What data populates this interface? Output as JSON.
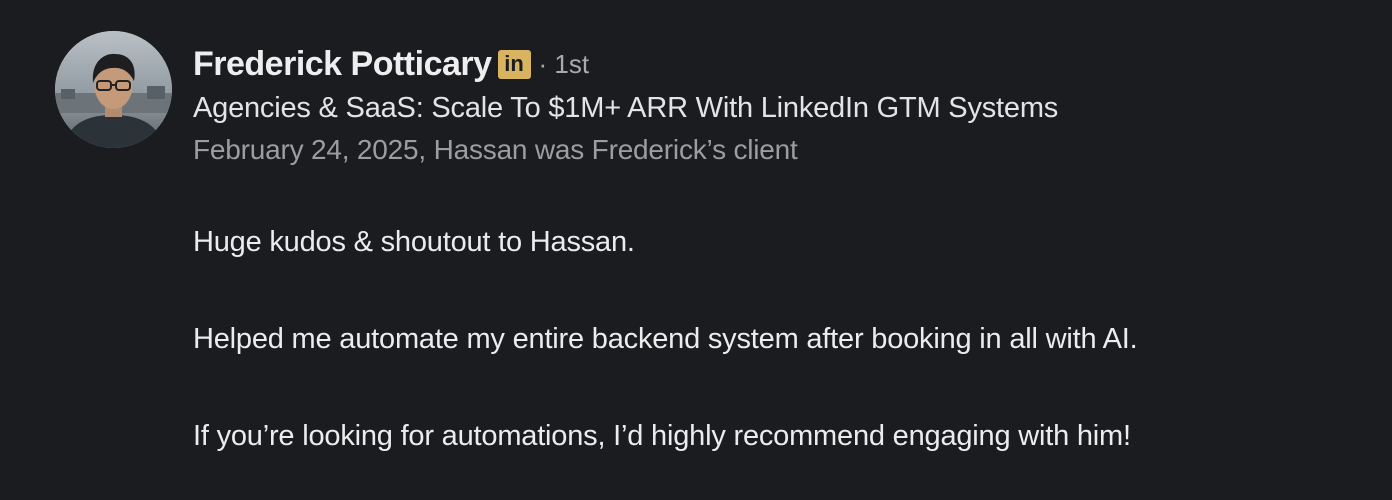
{
  "recommendation": {
    "author": {
      "name": "Frederick Potticary",
      "badge": "in",
      "connection_degree": "· 1st",
      "headline": "Agencies & SaaS: Scale To $1M+ ARR With LinkedIn GTM Systems"
    },
    "meta": "February 24, 2025, Hassan was Frederick’s client",
    "paragraphs": [
      "Huge kudos & shoutout to Hassan.",
      "Helped me automate my entire backend system after booking in all with AI.",
      "If you’re looking for automations, I’d highly recommend engaging with him!"
    ]
  },
  "colors": {
    "background": "#1b1c20",
    "badge": "#d8b460",
    "primary_text": "#eeeeef",
    "secondary_text": "#9c9da0"
  },
  "icons": {
    "avatar": "profile-photo",
    "badge": "linkedin-premium-badge-icon"
  }
}
